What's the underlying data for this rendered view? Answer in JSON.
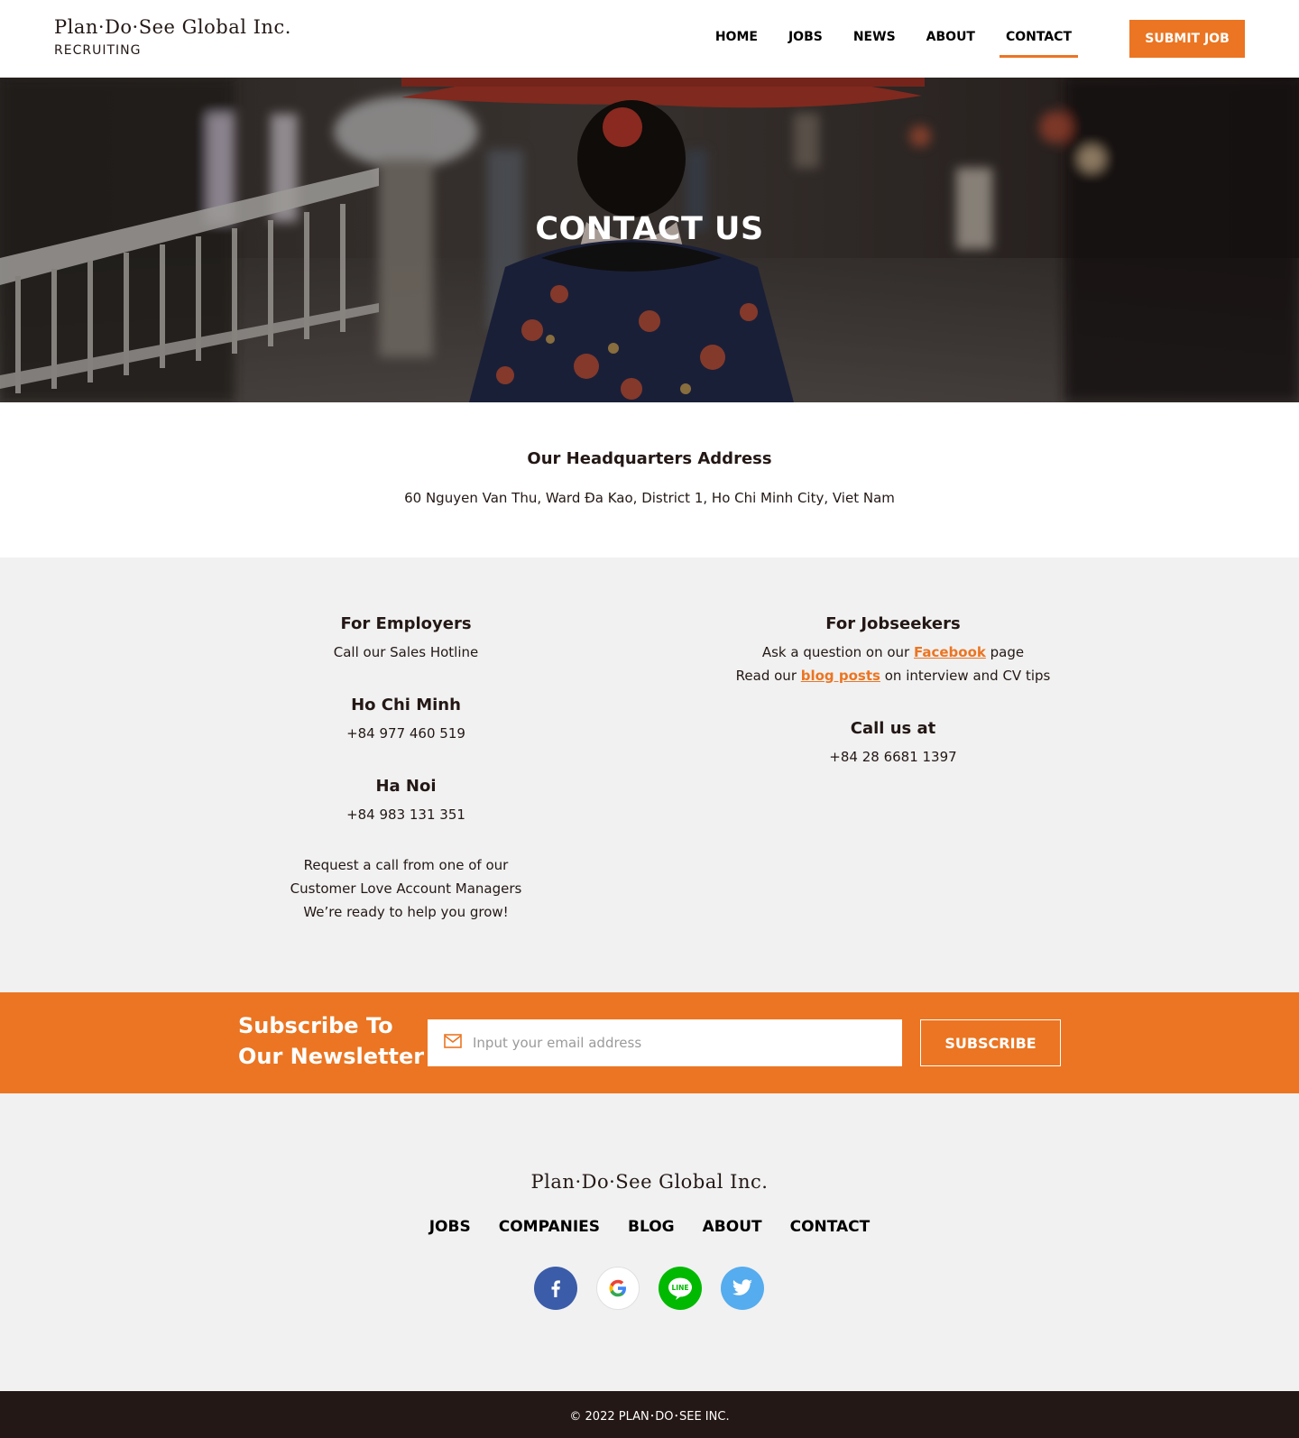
{
  "header": {
    "logo": "Plan·Do·See Global Inc.",
    "logo_sub": "RECRUITING",
    "nav": [
      "HOME",
      "JOBS",
      "NEWS",
      "ABOUT",
      "CONTACT"
    ],
    "active_nav": "CONTACT",
    "submit_label": "SUBMIT JOB"
  },
  "hero": {
    "title": "CONTACT US"
  },
  "address": {
    "heading": "Our Headquarters Address",
    "text": "60 Nguyen Van Thu, Ward Đa Kao, District 1, Ho Chi Minh City, Viet Nam"
  },
  "employers": {
    "heading": "For Employers",
    "subtitle": "Call our Sales Hotline",
    "hcm_heading": "Ho Chi Minh",
    "hcm_phone": "+84 977 460 519",
    "hn_heading": "Ha Noi",
    "hn_phone": "+84 983 131 351",
    "request_lines": [
      "Request a call from one of our",
      "Customer Love Account Managers",
      "We’re ready to help you grow!"
    ]
  },
  "jobseekers": {
    "heading": "For Jobseekers",
    "line1_pre": "Ask a question on our ",
    "line1_link": "Facebook",
    "line1_post": " page",
    "line2_pre": "Read our ",
    "line2_link": "blog posts",
    "line2_post": " on interview and CV tips",
    "call_heading": "Call us at",
    "call_phone": "+84 28 6681 1397"
  },
  "newsletter": {
    "title_line1": "Subscribe To",
    "title_line2": "Our Newsletter",
    "placeholder": "Input your email address",
    "button": "SUBSCRIBE"
  },
  "footer": {
    "logo": "Plan·Do·See Global Inc.",
    "nav": [
      "JOBS",
      "COMPANIES",
      "BLOG",
      "ABOUT",
      "CONTACT"
    ],
    "social": [
      "facebook-icon",
      "google-icon",
      "line-icon",
      "twitter-icon"
    ],
    "line_text": "LINE",
    "copyright": "© 2022 PLAN･DO･SEE INC."
  },
  "colors": {
    "accent": "#eb7522",
    "dark": "#231815",
    "light_bg": "#f1f1f1",
    "facebook": "#3b5ca8",
    "line": "#00b900",
    "twitter": "#55acee"
  }
}
